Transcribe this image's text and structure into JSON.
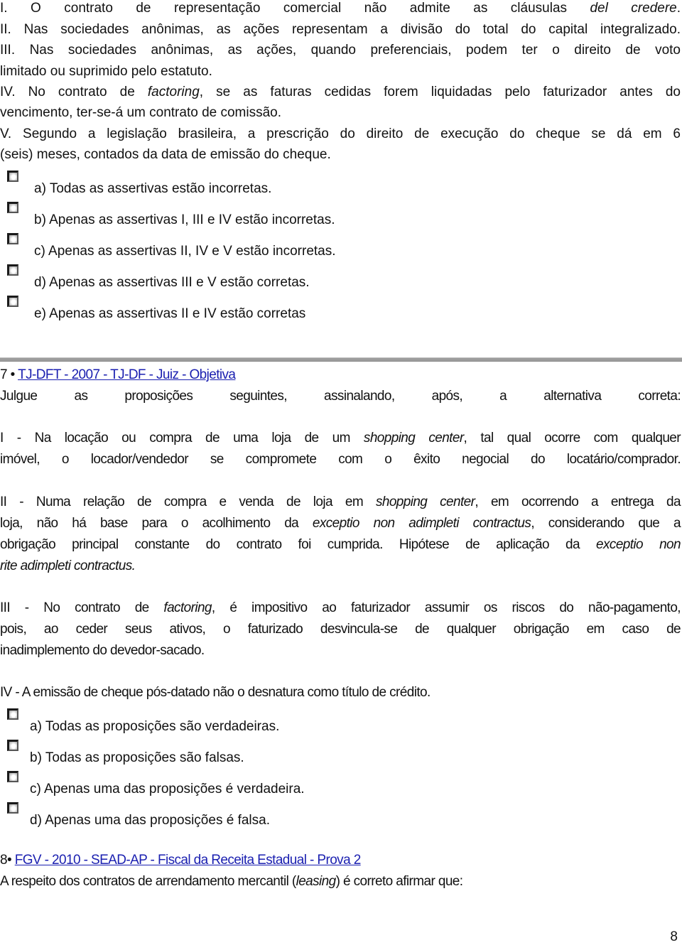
{
  "q6_tail": {
    "statements": [
      {
        "id": "I",
        "parts": [
          "I. O contrato de representação comercial não admite as cláusulas ",
          "del credere",
          "."
        ]
      },
      {
        "id": "II",
        "text": "II. Nas sociedades anônimas, as ações representam a divisão do total do capital integralizado."
      },
      {
        "id": "III",
        "line1": "III. Nas sociedades anônimas, as ações, quando preferenciais, podem ter o direito de voto",
        "line2": "limitado ou suprimido pelo estatuto."
      },
      {
        "id": "IV",
        "line1_pre": "IV. No contrato de ",
        "line1_em": "factoring",
        "line1_post": ", se as faturas cedidas forem liquidadas pelo faturizador antes do",
        "line2": "vencimento, ter-se-á um contrato de comissão."
      },
      {
        "id": "V",
        "line1": "V. Segundo a legislação brasileira, a prescrição do direito de execução do cheque se dá em 6",
        "line2": "(seis) meses, contados da data de emissão do cheque."
      }
    ],
    "options": [
      {
        "label": "a) Todas as assertivas estão incorretas.",
        "icon": "radio-icon"
      },
      {
        "label": "b) Apenas as assertivas I, III e IV estão incorretas.",
        "icon": "radio-icon"
      },
      {
        "label": "c) Apenas as assertivas II, IV e V estão incorretas.",
        "icon": "radio-icon"
      },
      {
        "label": "d) Apenas as assertivas III e V estão corretas.",
        "icon": "radio-icon"
      },
      {
        "label": "e) Apenas as assertivas II e IV estão corretas",
        "icon": "radio-icon"
      }
    ]
  },
  "q7": {
    "number": "7",
    "bullet": "•",
    "source_link": "TJ-DFT - 2007 - TJ-DF - Juiz - Objetiva",
    "prompt": "Julgue as proposições seguintes, assinalando, após, a alternativa correta:",
    "propositions": {
      "I": {
        "l1_pre": "I - Na locação ou compra de uma loja de um ",
        "l1_em": "shopping center",
        "l1_post": ", tal qual ocorre com qualquer",
        "l2": "imóvel, o locador/vendedor se compromete com o êxito negocial do locatário/comprador."
      },
      "II": {
        "l1_pre": "II - Numa relação de compra e venda de loja em ",
        "l1_em": "shopping center",
        "l1_post": ", em ocorrendo a entrega da",
        "l2_pre": "loja, não há base para o acolhimento da ",
        "l2_em": "exceptio non adimpleti contractus",
        "l2_post": ", considerando que a",
        "l3_pre": "obrigação principal constante do contrato foi cumprida. Hipótese de aplicação da ",
        "l3_em": "exceptio non",
        "l4_em": "rite adimpleti contractus."
      },
      "III": {
        "l1_pre": "III - No contrato de ",
        "l1_em": "factoring",
        "l1_post": ", é impositivo ao faturizador assumir os riscos do não-pagamento,",
        "l2": "pois, ao ceder seus ativos, o faturizado desvincula-se de qualquer obrigação em caso de",
        "l3": "inadimplemento do devedor-sacado."
      },
      "IV": {
        "l1": "IV - A emissão de cheque pós-datado não o desnatura como título de crédito."
      }
    },
    "options": [
      {
        "label": "a) Todas as proposições são verdadeiras.",
        "icon": "radio-icon"
      },
      {
        "label": "b) Todas as proposições são falsas.",
        "icon": "radio-icon"
      },
      {
        "label": "c) Apenas uma das proposições é verdadeira.",
        "icon": "radio-icon"
      },
      {
        "label": "d) Apenas uma das proposições é falsa.",
        "icon": "radio-icon"
      }
    ]
  },
  "q8": {
    "number": "8",
    "bullet": "•",
    "source_link": "FGV - 2010 - SEAD-AP - Fiscal da Receita Estadual - Prova 2",
    "prompt_pre": "A respeito dos contratos de arrendamento mercantil (",
    "prompt_em": "leasing",
    "prompt_post": ") é correto afirmar que:"
  },
  "footer": {
    "page_number": "8"
  },
  "colors": {
    "link": "#1a1fb0",
    "text": "#111111",
    "rule": "#9c9c9c"
  }
}
